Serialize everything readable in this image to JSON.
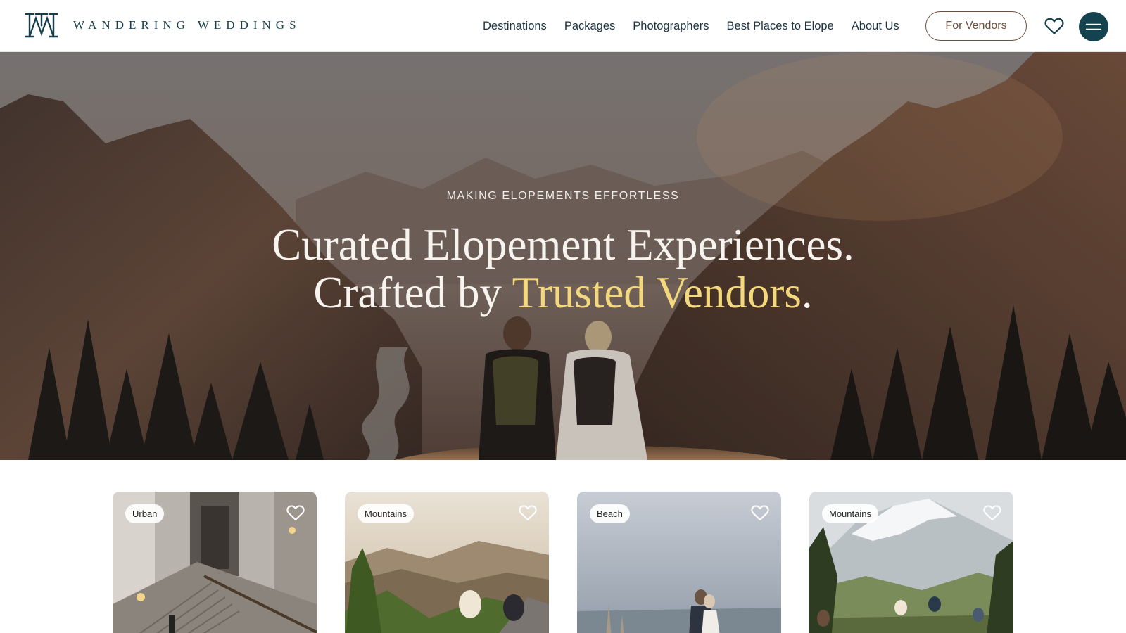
{
  "header": {
    "brand": "WANDERING WEDDINGS",
    "nav": [
      "Destinations",
      "Packages",
      "Photographers",
      "Best Places to Elope",
      "About Us"
    ],
    "vendors_button": "For Vendors",
    "favorites_icon": "heart-icon",
    "menu_icon": "hamburger-menu-icon"
  },
  "hero": {
    "eyebrow": "MAKING ELOPEMENTS EFFORTLESS",
    "headline_line1": "Curated Elopement Experiences.",
    "headline_line2_prefix": "Crafted by ",
    "headline_line2_accent": "Trusted Vendors",
    "headline_line2_suffix": "."
  },
  "cards": [
    {
      "tag": "Urban",
      "icon": "heart-icon"
    },
    {
      "tag": "Mountains",
      "icon": "heart-icon"
    },
    {
      "tag": "Beach",
      "icon": "heart-icon"
    },
    {
      "tag": "Mountains",
      "icon": "heart-icon"
    }
  ],
  "colors": {
    "brand_teal": "#14434f",
    "accent_gold": "#f4d87e",
    "vendor_brown": "#6b4f3f"
  }
}
